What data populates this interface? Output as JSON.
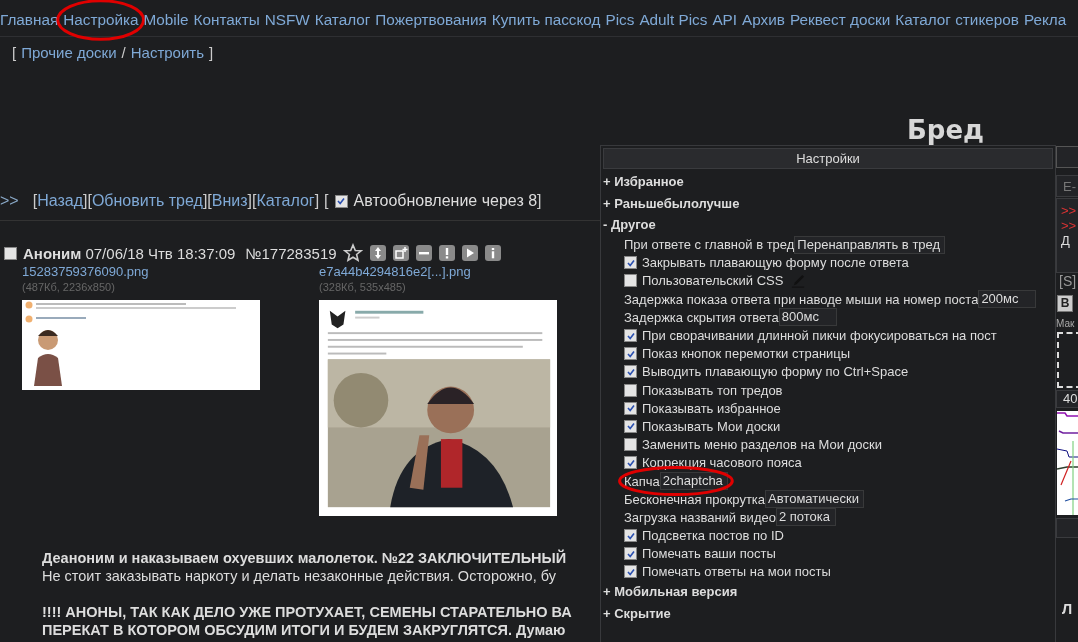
{
  "top_nav": {
    "links": [
      {
        "label": "Главная",
        "highlighted": false
      },
      {
        "label": "Настройка",
        "highlighted": true
      },
      {
        "label": "Mobile",
        "highlighted": false
      },
      {
        "label": "Контакты",
        "highlighted": false
      },
      {
        "label": "NSFW",
        "highlighted": false
      },
      {
        "label": "Каталог",
        "highlighted": false
      },
      {
        "label": "Пожертвования",
        "highlighted": false
      },
      {
        "label": "Купить пасскод",
        "highlighted": false
      },
      {
        "label": "Pics",
        "highlighted": false
      },
      {
        "label": "Adult Pics",
        "highlighted": false
      },
      {
        "label": "API",
        "highlighted": false
      },
      {
        "label": "Архив",
        "highlighted": false
      },
      {
        "label": "Реквест доски",
        "highlighted": false
      },
      {
        "label": "Каталог стикеров",
        "highlighted": false
      },
      {
        "label": "Рекла",
        "highlighted": false
      }
    ]
  },
  "board_links": {
    "open": "[",
    "links": [
      "Прочие доски",
      "Настроить"
    ],
    "separator": "/",
    "close": "]"
  },
  "board_title": "Бред",
  "thread_nav": {
    "arrow": ">>",
    "links": [
      {
        "open": "[",
        "label": "Назад",
        "close": "]"
      },
      {
        "open": "[",
        "label": "Обновить тред",
        "close": "]"
      },
      {
        "open": "[",
        "label": "Вниз",
        "close": "]"
      },
      {
        "open": "[",
        "label": "Каталог",
        "close": "]"
      }
    ],
    "autoupdate": {
      "open": "[",
      "label": "Автообновление через 8",
      "close": "]",
      "checked": true
    }
  },
  "post": {
    "selected": false,
    "author": "Аноним",
    "date": "07/06/18 Чтв 18:37:09",
    "number": "№177283519",
    "files": [
      {
        "name": "15283759376090.png",
        "meta": "(487Кб, 2236x850)",
        "kind": "picture"
      },
      {
        "name": "e7a44b4294816e2[...].png",
        "meta": "(328Кб, 535x485)",
        "kind": "picture"
      }
    ],
    "paragraphs": [
      {
        "lines": [
          {
            "text": "Деаноним и наказываем охуевших малолеток. №22 ЗАКЛЮЧИТЕЛЬНЫЙ",
            "bold": true
          },
          {
            "text": "Не стоит заказывать наркоту и делать незаконные действия. Осторожно, бу",
            "bold": false
          }
        ]
      },
      {
        "lines": [
          {
            "text": "!!!! АНОНЫ, ТАК КАК ДЕЛО УЖЕ ПРОТУХАЕТ, СЕМЕНЫ СТАРАТЕЛЬНО ВА",
            "bold": true
          },
          {
            "text": "ПЕРЕКАТ В КОТОРОМ ОБСУДИМ ИТОГИ И БУДЕМ ЗАКРУГЛЯТСЯ. Думаю",
            "bold": true
          }
        ]
      }
    ]
  },
  "settings_panel": {
    "title": "Настройки",
    "sections": [
      {
        "marker": "+",
        "label": "Избранное"
      },
      {
        "marker": "+",
        "label": "Раньшебылолучше"
      },
      {
        "marker": "-",
        "label": "Другое",
        "options": [
          {
            "kind": "select",
            "label": "При ответе с главной в тред",
            "value": "Перенаправлять в тред",
            "highlighted": false
          },
          {
            "kind": "checkbox",
            "label": "Закрывать плавающую форму после ответа",
            "checked": true,
            "highlighted": false
          },
          {
            "kind": "checkbox",
            "label": "Пользовательский CSS",
            "checked": false,
            "edit_icon": true,
            "highlighted": false
          },
          {
            "kind": "input",
            "label": "Задержка показа ответа при наводе мыши на номер поста",
            "value": "200мс",
            "highlighted": false
          },
          {
            "kind": "input",
            "label": "Задержка скрытия ответа",
            "value": "800мс",
            "highlighted": false
          },
          {
            "kind": "checkbox",
            "label": "При сворачивании длинной пикчи фокусироваться на пост",
            "checked": true,
            "highlighted": false
          },
          {
            "kind": "checkbox",
            "label": "Показ кнопок перемотки страницы",
            "checked": true,
            "highlighted": false
          },
          {
            "kind": "checkbox",
            "label": "Выводить плавающую форму по Ctrl+Space",
            "checked": true,
            "highlighted": false
          },
          {
            "kind": "checkbox",
            "label": "Показывать топ тредов",
            "checked": false,
            "highlighted": false
          },
          {
            "kind": "checkbox",
            "label": "Показывать избранное",
            "checked": true,
            "highlighted": false
          },
          {
            "kind": "checkbox",
            "label": "Показывать Мои доски",
            "checked": true,
            "highlighted": false
          },
          {
            "kind": "checkbox",
            "label": "Заменить меню разделов на Мои доски",
            "checked": false,
            "highlighted": false
          },
          {
            "kind": "checkbox",
            "label": "Коррекция часового пояса",
            "checked": true,
            "highlighted": false
          },
          {
            "kind": "select",
            "label": "Капча",
            "value": "2chaptcha",
            "highlighted": true
          },
          {
            "kind": "select",
            "label": "Бесконечная прокрутка",
            "value": "Автоматически",
            "highlighted": false
          },
          {
            "kind": "select",
            "label": "Загрузка названий видео",
            "value": "2 потока",
            "highlighted": false
          },
          {
            "kind": "checkbox",
            "label": "Подсветка постов по ID",
            "checked": true,
            "highlighted": false
          },
          {
            "kind": "checkbox",
            "label": "Помечать ваши посты",
            "checked": true,
            "highlighted": false
          },
          {
            "kind": "checkbox",
            "label": "Помечать ответы на мои посты",
            "checked": true,
            "highlighted": false
          }
        ]
      },
      {
        "marker": "+",
        "label": "Мобильная версия"
      },
      {
        "marker": "+",
        "label": "Скрытие"
      }
    ]
  },
  "reply_form": {
    "email_placeholder": "E-",
    "message_lines": [
      ">>",
      ">>",
      "Д"
    ],
    "sage": "[S]",
    "bold_button": "B",
    "hint": "Мак",
    "captcha_field": "40",
    "kind": "picture",
    "text_fragment": "Л"
  }
}
